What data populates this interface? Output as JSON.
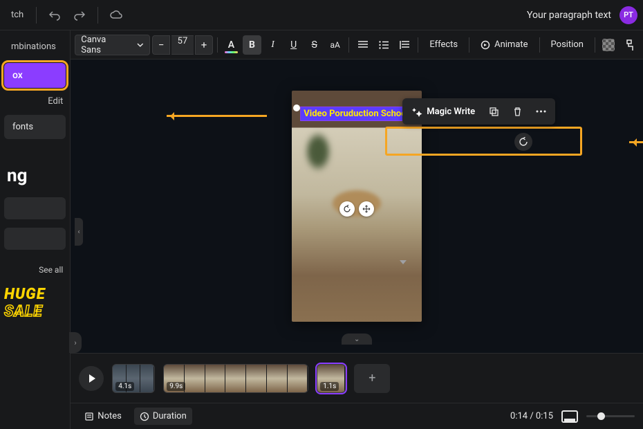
{
  "topbar": {
    "switch_label": "tch",
    "doc_title": "Your paragraph text",
    "avatar_initials": "PT"
  },
  "sidebar": {
    "combinations_tab": "mbinations",
    "textbox_btn": "ox",
    "edit_label": "Edit",
    "fonts_item": "fonts",
    "ng_text": "ng",
    "see_all": "See all",
    "huge": "HUGE",
    "sale": "SALE"
  },
  "toolbar": {
    "font_name": "Canva Sans",
    "font_size": "57",
    "minus": "−",
    "plus": "+",
    "color_letter": "A",
    "bold": "B",
    "italic": "I",
    "underline": "U",
    "strike": "S",
    "case": "aA",
    "effects": "Effects",
    "animate": "Animate",
    "position": "Position"
  },
  "floating": {
    "magic_write": "Magic Write"
  },
  "canvas": {
    "text_content": "Video Poruduction School"
  },
  "timeline": {
    "clip1_time": "4.1s",
    "clip2_time": "9.9s",
    "clip3_time": "1.1s"
  },
  "bottombar": {
    "notes": "Notes",
    "duration": "Duration",
    "timecode": "0:14 / 0:15"
  }
}
